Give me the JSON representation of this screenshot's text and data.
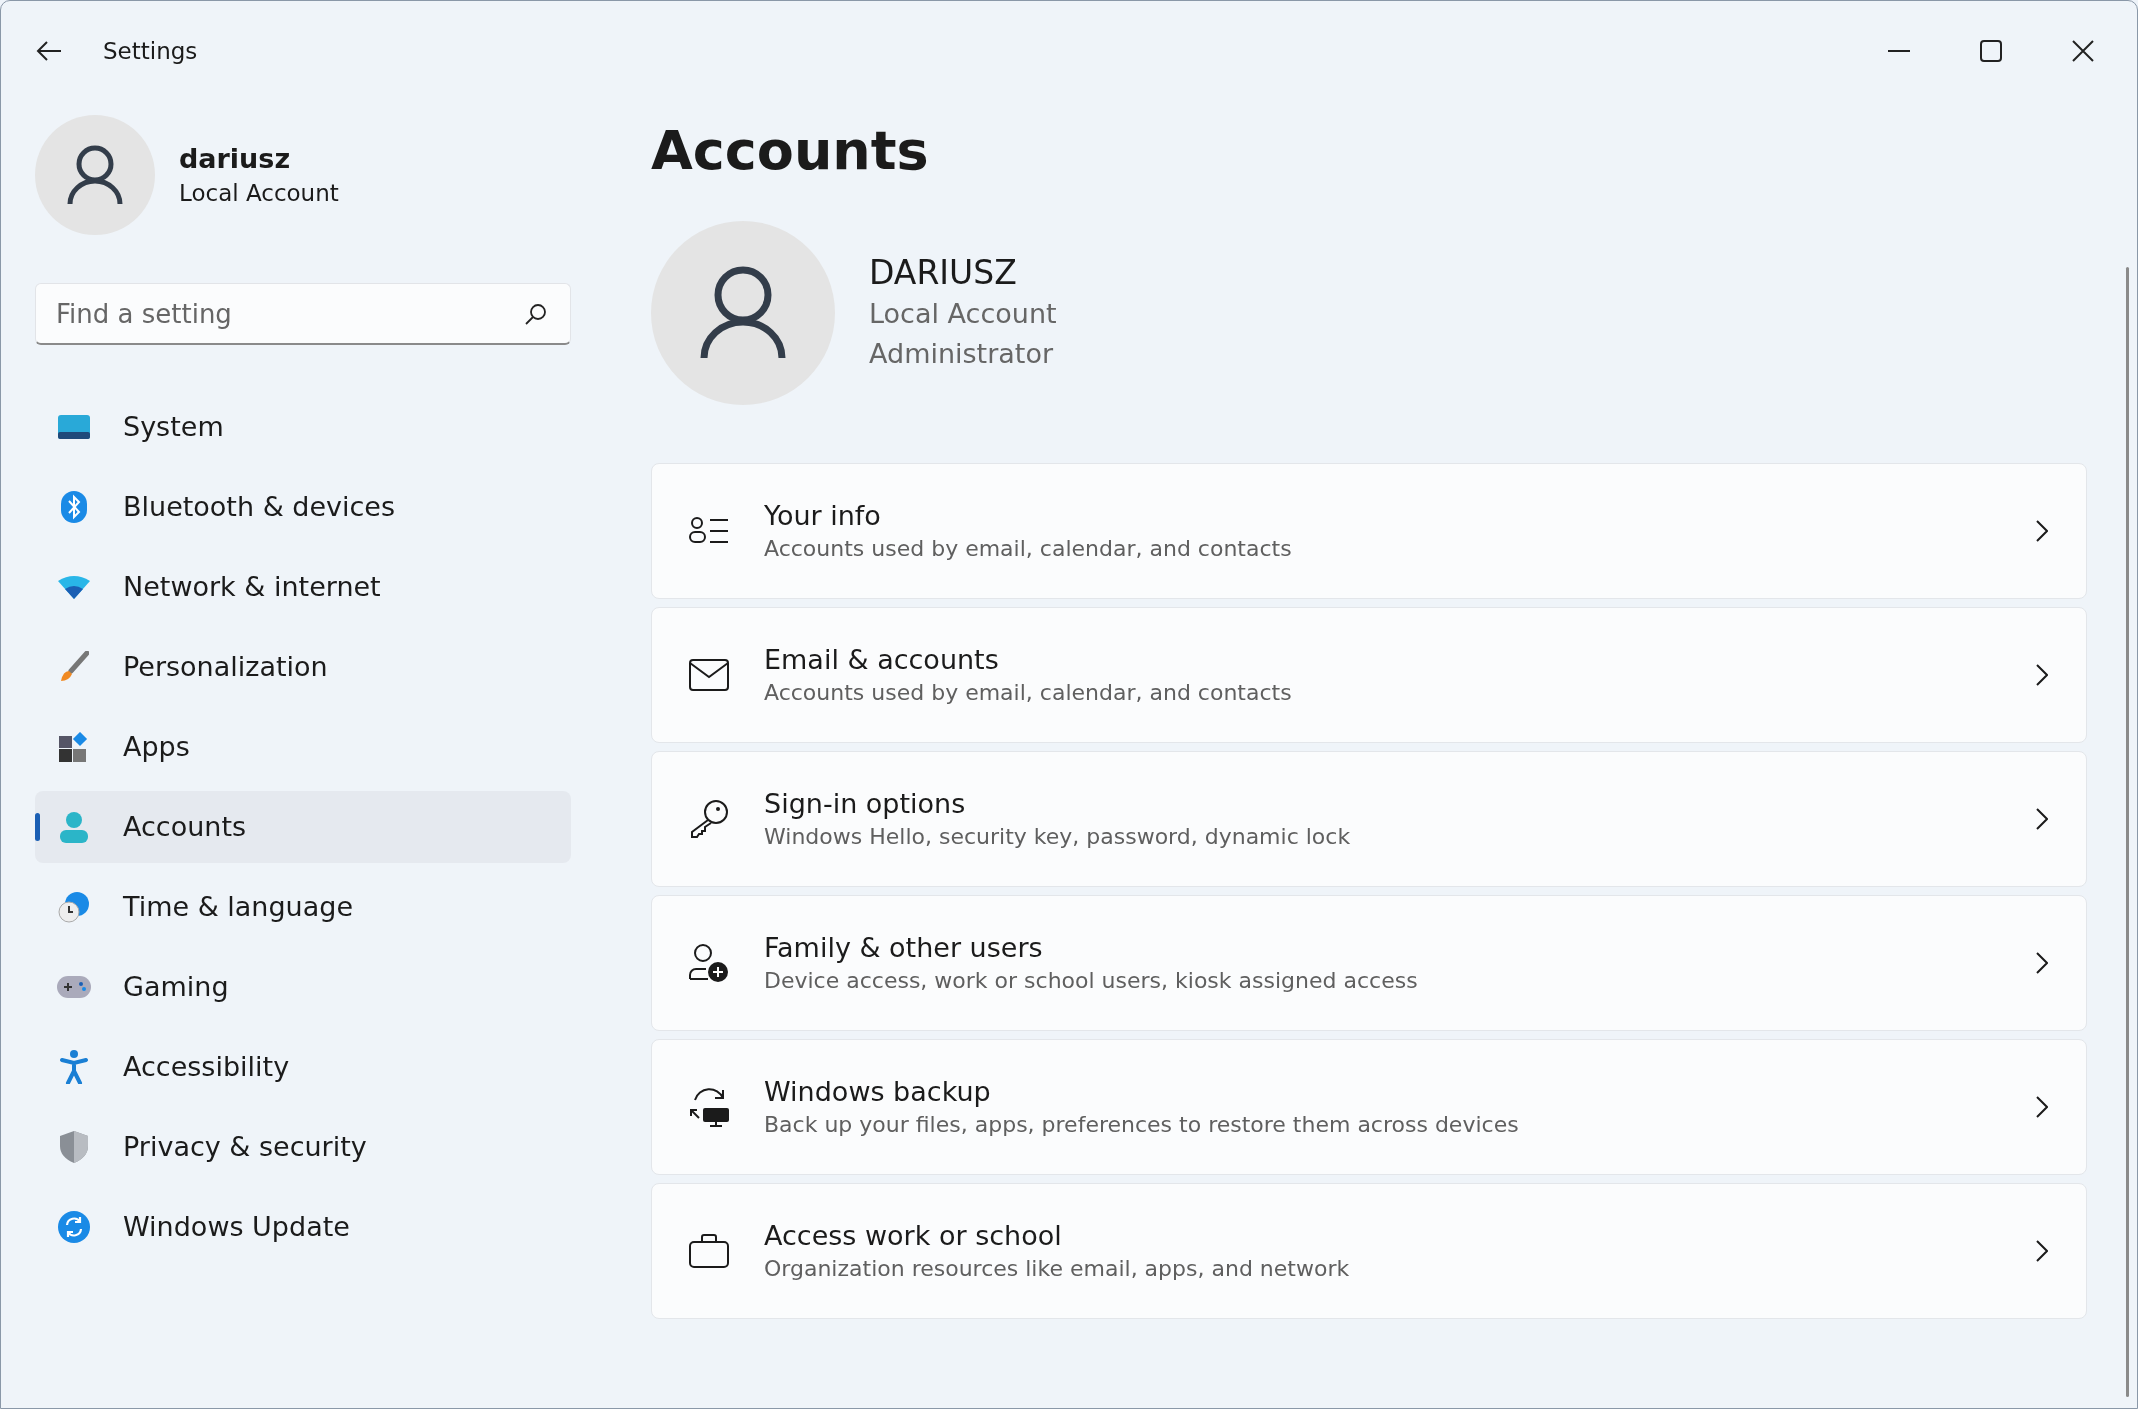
{
  "window": {
    "title": "Settings"
  },
  "user": {
    "name": "dariusz",
    "account_type": "Local Account"
  },
  "search": {
    "placeholder": "Find a setting"
  },
  "nav": [
    {
      "label": "System",
      "selected": false
    },
    {
      "label": "Bluetooth & devices",
      "selected": false
    },
    {
      "label": "Network & internet",
      "selected": false
    },
    {
      "label": "Personalization",
      "selected": false
    },
    {
      "label": "Apps",
      "selected": false
    },
    {
      "label": "Accounts",
      "selected": true
    },
    {
      "label": "Time & language",
      "selected": false
    },
    {
      "label": "Gaming",
      "selected": false
    },
    {
      "label": "Accessibility",
      "selected": false
    },
    {
      "label": "Privacy & security",
      "selected": false
    },
    {
      "label": "Windows Update",
      "selected": false
    }
  ],
  "page": {
    "title": "Accounts",
    "profile": {
      "name": "DARIUSZ",
      "lines": [
        "Local Account",
        "Administrator"
      ]
    }
  },
  "cards": [
    {
      "title": "Your info",
      "subtitle": "Accounts used by email, calendar, and contacts"
    },
    {
      "title": "Email & accounts",
      "subtitle": "Accounts used by email, calendar, and contacts"
    },
    {
      "title": "Sign-in options",
      "subtitle": "Windows Hello, security key, password, dynamic lock"
    },
    {
      "title": "Family & other users",
      "subtitle": "Device access, work or school users, kiosk assigned access"
    },
    {
      "title": "Windows backup",
      "subtitle": "Back up your files, apps, preferences to restore them across devices"
    },
    {
      "title": "Access work or school",
      "subtitle": "Organization resources like email, apps, and network"
    }
  ]
}
